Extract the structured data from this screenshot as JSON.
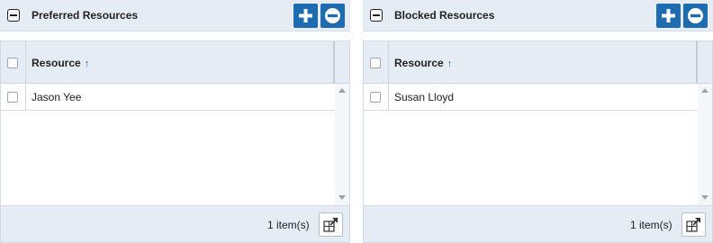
{
  "panels": [
    {
      "title": "Preferred Resources",
      "column": "Resource",
      "sort_indicator": "↑",
      "rows": [
        "Jason Yee"
      ],
      "count": "1 item(s)"
    },
    {
      "title": "Blocked Resources",
      "column": "Resource",
      "sort_indicator": "↑",
      "rows": [
        "Susan Lloyd"
      ],
      "count": "1 item(s)"
    }
  ],
  "icons": {
    "collapse": "collapse-minus-icon",
    "add": "plus-icon",
    "remove": "minus-circle-icon",
    "export": "open-window-icon"
  },
  "colors": {
    "accent": "#1f6bb0",
    "header_bg": "#e6ecf3",
    "sort_arrow": "#2a73c0"
  }
}
